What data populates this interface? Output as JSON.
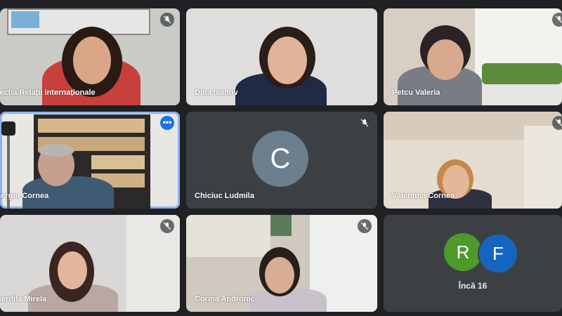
{
  "participants": [
    {
      "name": "Secția Relații internaționale",
      "muted": true
    },
    {
      "name": "Dina Ivanov",
      "muted": false
    },
    {
      "name": "Petcu Valeria",
      "muted": true
    },
    {
      "name": "Sergiu Cornea",
      "muted": false,
      "active": true
    },
    {
      "name": "Chiciuc Ludmila",
      "muted": true,
      "avatar_letter": "C",
      "avatar_color": "#6b7f8e"
    },
    {
      "name": "Valentina Cornea",
      "muted": true
    },
    {
      "name": "Berdila Mirela",
      "muted": true
    },
    {
      "name": "Corina Andronic",
      "muted": true
    },
    {
      "name": "",
      "overflow": true
    }
  ],
  "overflow_tile": {
    "avatars": [
      {
        "letter": "R",
        "color": "#4c9a2a"
      },
      {
        "letter": "F",
        "color": "#1565c0"
      }
    ],
    "more_label": "Încă 16"
  },
  "colors": {
    "background": "#202124",
    "active_outline": "#8ab4f8",
    "more_button": "#1a73e8"
  }
}
